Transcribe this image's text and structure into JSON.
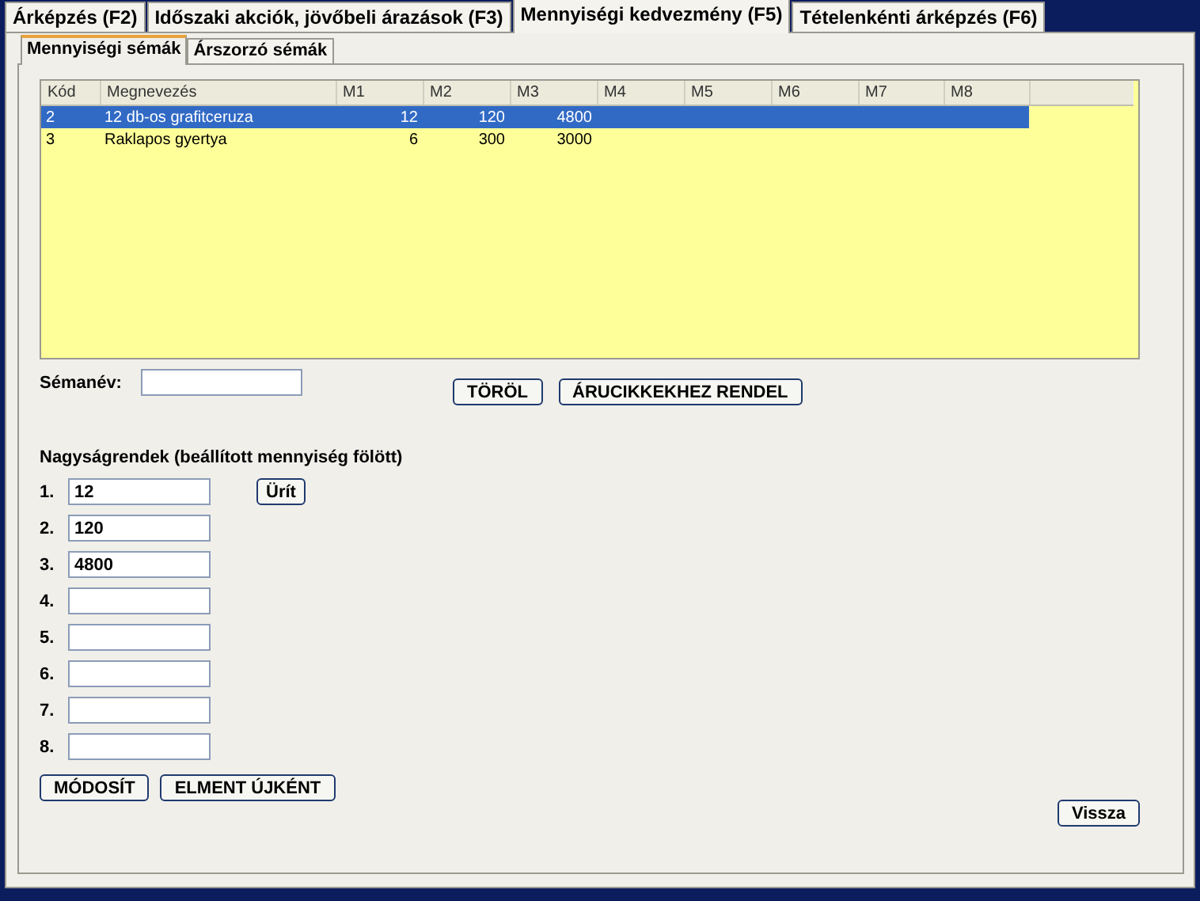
{
  "main_tabs": [
    {
      "label": "Árképzés (F2)",
      "selected": false
    },
    {
      "label": "Időszaki akciók, jövőbeli árazások (F3)",
      "selected": false
    },
    {
      "label": "Mennyiségi kedvezmény (F5)",
      "selected": true
    },
    {
      "label": "Tételenkénti árképzés (F6)",
      "selected": false
    }
  ],
  "sub_tabs": [
    {
      "label": "Mennyiségi sémák",
      "selected": true
    },
    {
      "label": "Árszorzó sémák",
      "selected": false
    }
  ],
  "table": {
    "columns": [
      "Kód",
      "Megnevezés",
      "M1",
      "M2",
      "M3",
      "M4",
      "M5",
      "M6",
      "M7",
      "M8"
    ],
    "rows": [
      {
        "selected": true,
        "cells": [
          "2",
          "12 db-os grafitceruza",
          "12",
          "120",
          "4800"
        ]
      },
      {
        "selected": false,
        "cells": [
          "3",
          "Raklapos gyertya",
          "6",
          "300",
          "3000"
        ]
      }
    ]
  },
  "scheme_name": {
    "label": "Sémanév:"
  },
  "actions": [
    "TÖRÖL",
    "ÁRUCIKKEKHEZ RENDEL"
  ],
  "levels_heading": "Nagyságrendek (beállított mennyiség fölött)",
  "levels": [
    {
      "label": "1.",
      "value": "12"
    },
    {
      "label": "2.",
      "value": "120"
    },
    {
      "label": "3.",
      "value": "4800"
    },
    {
      "label": "4."
    },
    {
      "label": "5."
    },
    {
      "label": "6."
    },
    {
      "label": "7."
    },
    {
      "label": "8."
    }
  ],
  "clear_button": "Ürít",
  "bottom_buttons": [
    "MÓDOSÍT",
    "ELMENT ÚJKÉNT"
  ],
  "back_button": "Vissza"
}
